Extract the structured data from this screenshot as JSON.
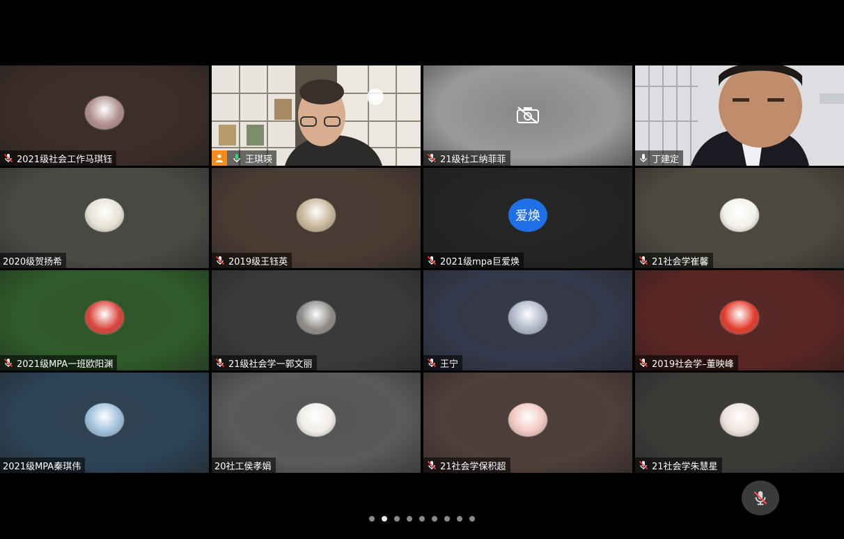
{
  "participants": [
    {
      "name": "2021级社会工作马琪钰",
      "mic": "muted",
      "bg": "#3c2d28",
      "avatar": "photo",
      "avatarColor": "#b08d8d"
    },
    {
      "name": "王琪瑛",
      "mic": "on",
      "host": true,
      "active": true,
      "bg": "video-room"
    },
    {
      "name": "21级社工纳菲菲",
      "mic": "muted",
      "bg": "#9a9a9a",
      "camera": "off"
    },
    {
      "name": "丁建定",
      "mic": "on",
      "bg": "video-man"
    },
    {
      "name": "2020级贺扬希",
      "mic": "none",
      "bg": "#4b4a45",
      "avatar": "photo",
      "avatarColor": "#e6e2d5"
    },
    {
      "name": "2019级王钰英",
      "mic": "muted",
      "bg": "#4a3b33",
      "avatar": "photo",
      "avatarColor": "#c7b595"
    },
    {
      "name": "2021级mpa巨爱焕",
      "mic": "muted",
      "bg": "#232323",
      "avatarText": "爱焕"
    },
    {
      "name": "21社会学崔馨",
      "mic": "muted",
      "bg": "#4e4a3f",
      "avatar": "photo",
      "avatarColor": "#f4f1ea"
    },
    {
      "name": "2021级MPA一班欧阳渊",
      "mic": "muted",
      "bg": "#2f5b2a",
      "avatar": "photo",
      "avatarColor": "#d9433a"
    },
    {
      "name": "21级社会学一郭文丽",
      "mic": "muted",
      "bg": "#3a3a38",
      "avatar": "photo",
      "avatarColor": "#8f8b88"
    },
    {
      "name": "王宁",
      "mic": "muted",
      "bg": "#33384a",
      "avatar": "photo",
      "avatarColor": "#aeb7c8"
    },
    {
      "name": "2019社会学–董映峰",
      "mic": "muted",
      "bg": "#5a2622",
      "avatar": "photo",
      "avatarColor": "#e23b2c"
    },
    {
      "name": "2021级MPA秦琪伟",
      "mic": "none",
      "bg": "#2c4356",
      "avatar": "photo",
      "avatarColor": "#9ec0da"
    },
    {
      "name": "20社工侯孝娟",
      "mic": "none",
      "bg": "#5a5a5a",
      "avatar": "photo",
      "avatarColor": "#f1ede8"
    },
    {
      "name": "21社会学保积超",
      "mic": "muted",
      "bg": "#4f3e3a",
      "avatar": "photo",
      "avatarColor": "#f2c7c1"
    },
    {
      "name": "21社会学朱慧星",
      "mic": "muted",
      "bg": "#3d3b38",
      "avatar": "photo",
      "avatarColor": "#efe3dc"
    }
  ],
  "pagination": {
    "count": 9,
    "active": 1
  },
  "controls": {
    "mute_icon": "mic-muted-icon"
  },
  "colors": {
    "active_border": "#26c06a",
    "host_badge": "#f28c1a",
    "avatar_blue": "#1f6fe6",
    "mic_green": "#2bd46e"
  }
}
